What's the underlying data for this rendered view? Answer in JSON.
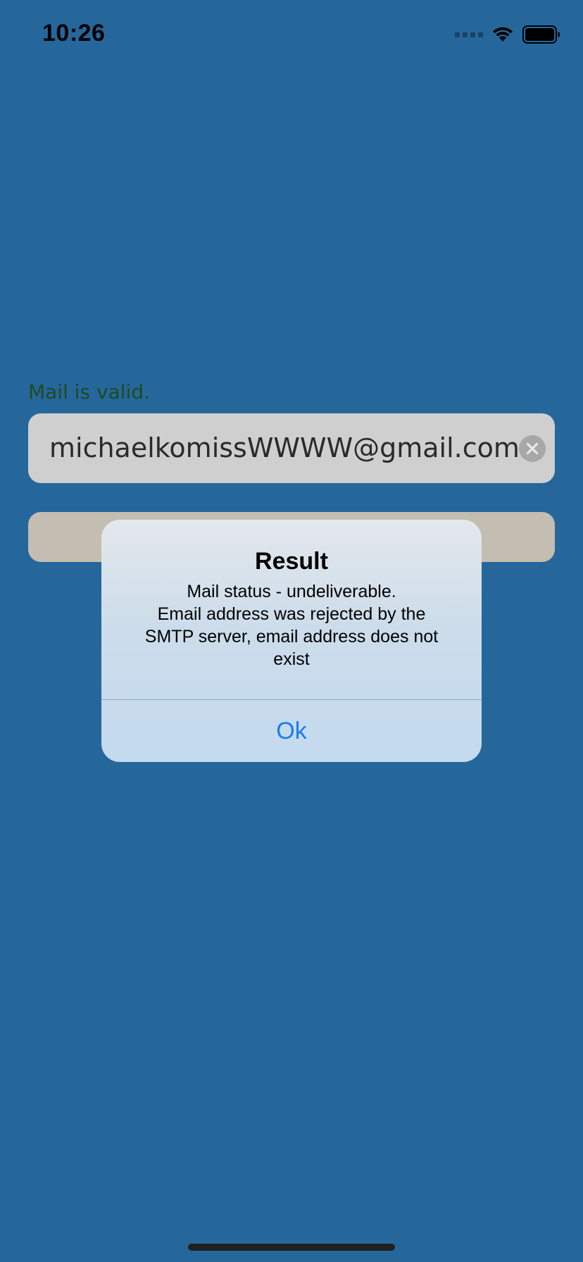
{
  "status_bar": {
    "time": "10:26",
    "icons": [
      "signal-icon",
      "wifi-icon",
      "battery-icon"
    ]
  },
  "form": {
    "validation_text": "Mail is valid.",
    "validation_color": "#1f4a22",
    "email_value": "michaelkomissWWWW@gmail.com",
    "clear_icon": "clear-icon"
  },
  "alert": {
    "title": "Result",
    "message_lines": [
      "Mail status - undeliverable.",
      "Email address was rejected by the",
      "SMTP server, email address does not",
      "exist"
    ],
    "ok_label": "Ok",
    "ok_color": "#1b7cf0"
  },
  "colors": {
    "background": "#25679b",
    "input_background": "#cfcfcf",
    "button_background": "#c3beb1"
  }
}
